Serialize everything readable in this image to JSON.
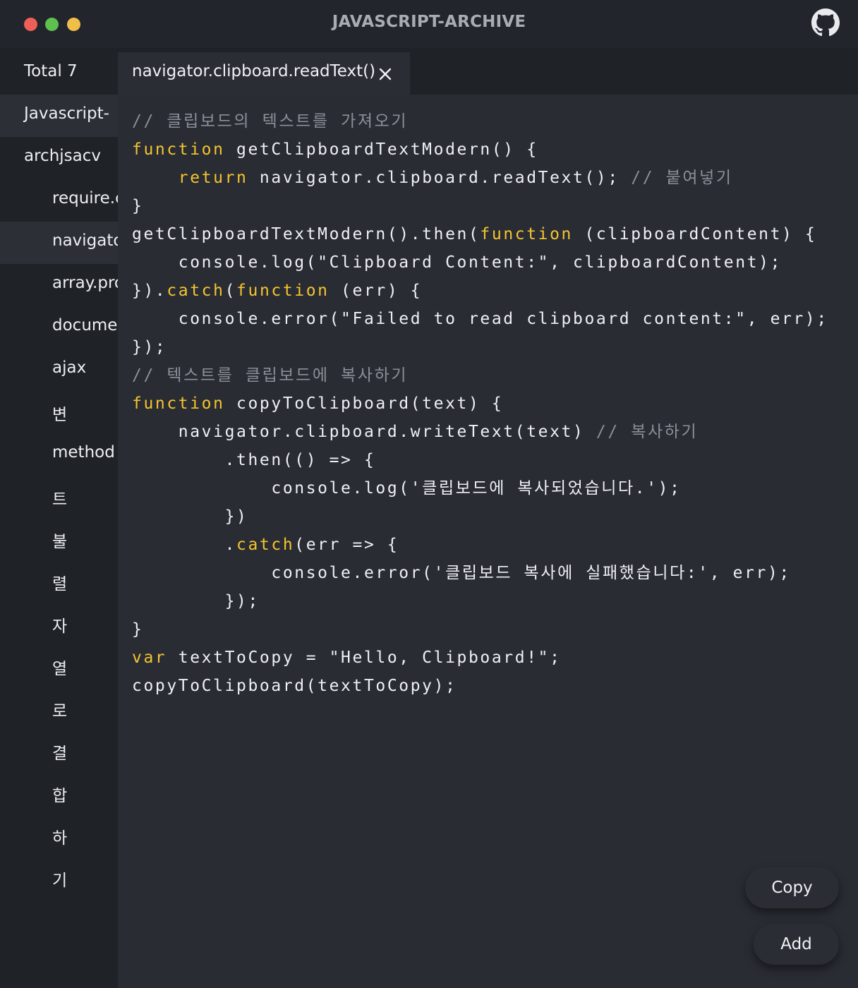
{
  "app": {
    "title": "JAVASCRIPT-ARCHIVE",
    "github_icon": "github-icon"
  },
  "sidebar": {
    "total_label": "Total 7",
    "folders": [
      {
        "label": "Javascript-"
      },
      {
        "label": "archjsacv"
      }
    ],
    "items": [
      {
        "label": "require.c"
      },
      {
        "label": "navigato"
      },
      {
        "label": "array.pro"
      },
      {
        "label": "documer"
      },
      {
        "label": "ajax"
      },
      {
        "label": "변"
      },
      {
        "label": "method"
      },
      {
        "label": "트"
      },
      {
        "label": "불"
      },
      {
        "label": "렬"
      },
      {
        "label": "자"
      },
      {
        "label": "열"
      },
      {
        "label": "로"
      },
      {
        "label": "결"
      },
      {
        "label": "합"
      },
      {
        "label": "하"
      },
      {
        "label": "기"
      }
    ]
  },
  "tabs": [
    {
      "label": "navigator.clipboard.readText()"
    }
  ],
  "editor": {
    "lines": [
      [
        {
          "t": "cm",
          "s": "// 클립보드의 텍스트를 가져오기"
        }
      ],
      [
        {
          "t": "kw",
          "s": "function"
        },
        {
          "t": "tx",
          "s": " getClipboardTextModern() {"
        }
      ],
      [
        {
          "t": "tx",
          "s": "    "
        },
        {
          "t": "kw",
          "s": "return"
        },
        {
          "t": "tx",
          "s": " navigator.clipboard.readText(); "
        },
        {
          "t": "cm",
          "s": "// 붙여넣기"
        }
      ],
      [
        {
          "t": "tx",
          "s": "}"
        }
      ],
      [
        {
          "t": "tx",
          "s": "getClipboardTextModern().then("
        },
        {
          "t": "kw",
          "s": "function"
        },
        {
          "t": "tx",
          "s": " (clipboardContent) {"
        }
      ],
      [
        {
          "t": "tx",
          "s": "    console.log(\"Clipboard Content:\", clipboardContent);"
        }
      ],
      [
        {
          "t": "tx",
          "s": "})."
        },
        {
          "t": "kw",
          "s": "catch"
        },
        {
          "t": "tx",
          "s": "("
        },
        {
          "t": "kw",
          "s": "function"
        },
        {
          "t": "tx",
          "s": " (err) {"
        }
      ],
      [
        {
          "t": "tx",
          "s": "    console.error(\"Failed to read clipboard content:\", err);"
        }
      ],
      [
        {
          "t": "tx",
          "s": "});"
        }
      ],
      [
        {
          "t": "cm",
          "s": "// 텍스트를 클립보드에 복사하기"
        }
      ],
      [
        {
          "t": "kw",
          "s": "function"
        },
        {
          "t": "tx",
          "s": " copyToClipboard(text) {"
        }
      ],
      [
        {
          "t": "tx",
          "s": "    navigator.clipboard.writeText(text) "
        },
        {
          "t": "cm",
          "s": "// 복사하기"
        }
      ],
      [
        {
          "t": "tx",
          "s": "        .then(() => {"
        }
      ],
      [
        {
          "t": "tx",
          "s": "            console.log('클립보드에 복사되었습니다.');"
        }
      ],
      [
        {
          "t": "tx",
          "s": "        })"
        }
      ],
      [
        {
          "t": "tx",
          "s": "        ."
        },
        {
          "t": "kw",
          "s": "catch"
        },
        {
          "t": "tx",
          "s": "(err => {"
        }
      ],
      [
        {
          "t": "tx",
          "s": "            console.error('클립보드 복사에 실패했습니다:', err);"
        }
      ],
      [
        {
          "t": "tx",
          "s": "        });"
        }
      ],
      [
        {
          "t": "tx",
          "s": "}"
        }
      ],
      [
        {
          "t": "kw",
          "s": "var"
        },
        {
          "t": "tx",
          "s": " textToCopy = \"Hello, Clipboard!\";"
        }
      ],
      [
        {
          "t": "tx",
          "s": "copyToClipboard(textToCopy);"
        }
      ]
    ]
  },
  "actions": {
    "copy_label": "Copy",
    "add_label": "Add"
  },
  "colors": {
    "keyword": "#f4c430",
    "comment": "#8b8f97",
    "text": "#eef0f3",
    "close_dot": "#ee5f57",
    "zoom_dot": "#5ec04f",
    "minimize_dot": "#f2be4a"
  }
}
